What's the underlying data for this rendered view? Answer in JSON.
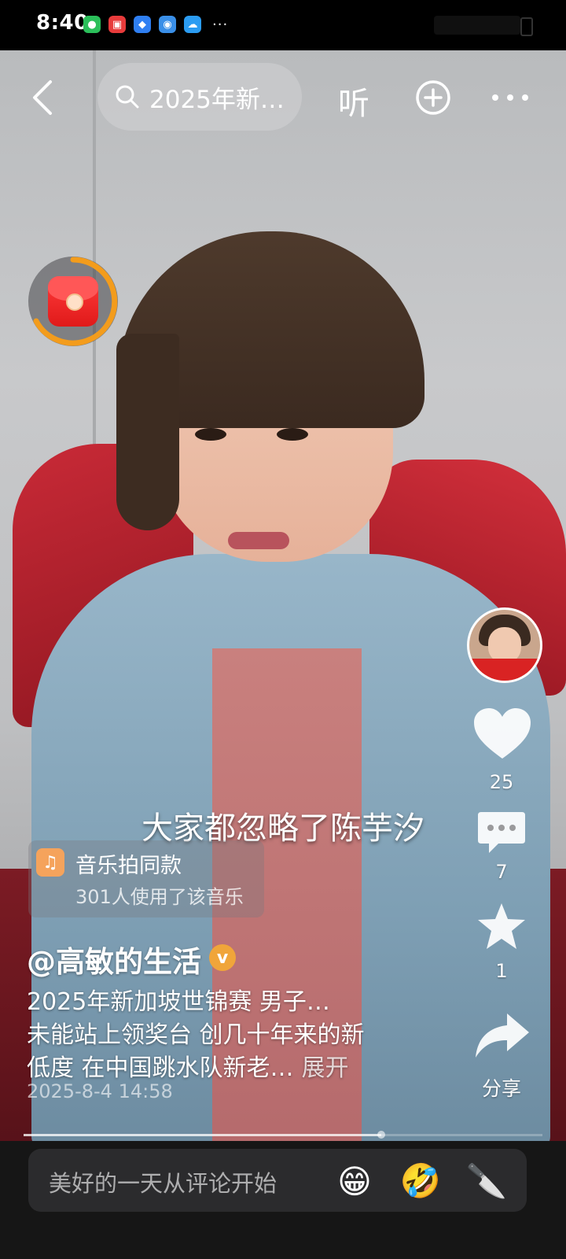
{
  "status_bar": {
    "time": "8:40",
    "more": "···"
  },
  "top_bar": {
    "search_text": "2025年新…",
    "listen_label": "听"
  },
  "video": {
    "subtitle": "大家都忽略了陈芋汐"
  },
  "music": {
    "title": "音乐拍同款",
    "usage": "301人使用了该音乐"
  },
  "post": {
    "author": "@高敏的生活",
    "verified_label": "v",
    "description_lines": [
      "2025年新加坡世锦赛 男子…",
      "未能站上领奖台 创几十年来的新",
      "低度 在中国跳水队新老…"
    ],
    "expand_label": "展开",
    "date": "2025-8-4 14:58",
    "progress": 0.69
  },
  "actions": {
    "like_count": "25",
    "comment_count": "7",
    "favorite_count": "1",
    "share_label": "分享"
  },
  "comment_bar": {
    "placeholder": "美好的一天从评论开始",
    "emoji_1": "😁",
    "emoji_2": "🤣",
    "emoji_3": "🔪"
  },
  "colors": {
    "redpack_ring": "#f39c1c",
    "verified": "#f0a53a",
    "music_icon": "#f5a35c"
  }
}
